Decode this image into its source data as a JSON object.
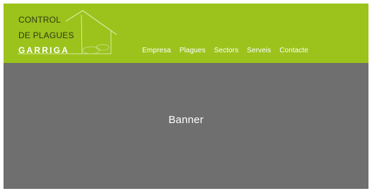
{
  "logo": {
    "line1": "CONTROL",
    "line2": "DE PLAGUES",
    "brand": "GARRIGA",
    "icon": "house-outline-icon"
  },
  "nav": {
    "items": [
      {
        "label": "Empresa"
      },
      {
        "label": "Plagues"
      },
      {
        "label": "Sectors"
      },
      {
        "label": "Serveis"
      },
      {
        "label": "Contacte"
      }
    ]
  },
  "banner": {
    "label": "Banner"
  },
  "colors": {
    "header_green": "#9bc31c",
    "banner_gray": "#6f6f6f",
    "nav_text": "#ffffff",
    "logo_text": "#2f3a14"
  }
}
